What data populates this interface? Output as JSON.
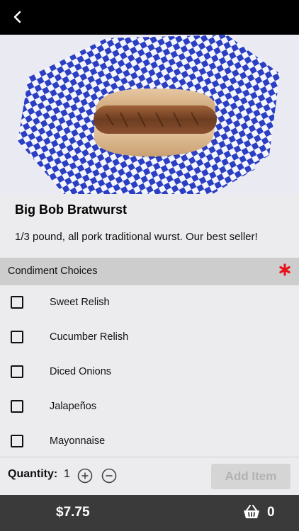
{
  "item": {
    "name": "Big Bob Bratwurst",
    "description": "1/3 pound, all pork traditional wurst. Our best seller!",
    "image_icon": "bratwurst-photo"
  },
  "condiments": {
    "title": "Condiment Choices",
    "required_icon": "asterisk-icon",
    "required_color": "#e8121b",
    "options": [
      {
        "label": "Sweet Relish",
        "checked": false
      },
      {
        "label": "Cucumber Relish",
        "checked": false
      },
      {
        "label": "Diced Onions",
        "checked": false
      },
      {
        "label": "Jalapeños",
        "checked": false
      },
      {
        "label": "Mayonnaise",
        "checked": false
      }
    ]
  },
  "quantity": {
    "label": "Quantity:",
    "value": "1",
    "plus_icon": "plus-circle-icon",
    "minus_icon": "minus-circle-icon"
  },
  "actions": {
    "add_item_label": "Add Item"
  },
  "cart": {
    "price": "$7.75",
    "count": "0",
    "icon": "basket-icon"
  },
  "nav": {
    "back_icon": "chevron-left-icon"
  },
  "colors": {
    "top_bar": "#000000",
    "bottom_bar": "#3a3a3a",
    "section_header": "#cdcdcd",
    "background": "#ececee",
    "checker_blue": "#2b3fc4"
  }
}
